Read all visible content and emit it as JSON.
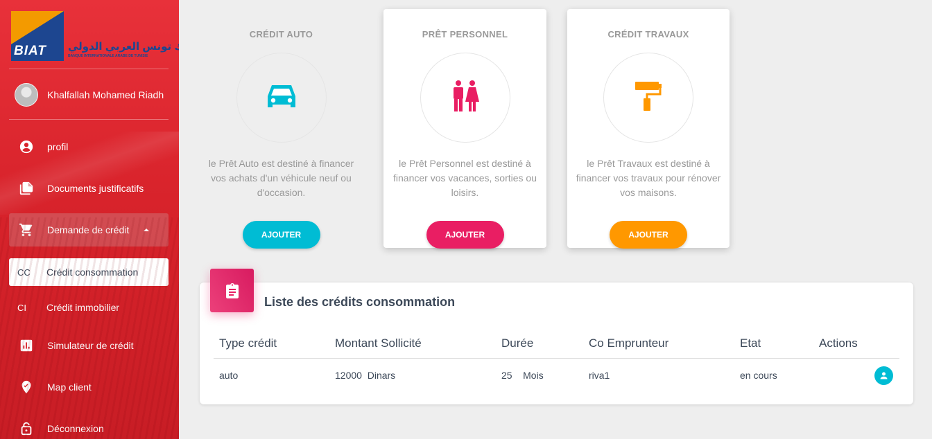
{
  "brand": {
    "logo_text": "BIAT",
    "arabic_name": "بنك تونس العربي الدولي",
    "full_name": "BANQUE INTERNATIONALE ARABE DE TUNISIE",
    "primary_color": "#d8232b",
    "logo_blue": "#1d4690",
    "logo_orange": "#f39a00"
  },
  "user": {
    "name": "Khalfallah Mohamed Riadh",
    "icon": "account-circle-icon"
  },
  "sidebar": {
    "items": [
      {
        "label": "profil",
        "icon": "account-icon"
      },
      {
        "label": "Documents justificatifs",
        "icon": "documents-icon"
      },
      {
        "label": "Demande de crédit",
        "icon": "cart-icon"
      }
    ],
    "submenu": [
      {
        "abbr": "CC",
        "label": "Crédit consommation"
      },
      {
        "abbr": "CI",
        "label": "Crédit immobilier"
      }
    ],
    "bottom_items": [
      {
        "label": "Simulateur de crédit",
        "icon": "chart-icon"
      },
      {
        "label": "Map client",
        "icon": "map-pin-icon"
      },
      {
        "label": "Déconnexion",
        "icon": "lock-icon"
      }
    ]
  },
  "cards": [
    {
      "title": "CRÉDIT AUTO",
      "description": "le Prêt Auto est destiné à financer vos achats d'un véhicule neuf ou d'occasion.",
      "button": "AJOUTER",
      "color": "#00bcd4",
      "icon": "car-icon"
    },
    {
      "title": "PRÊT PERSONNEL",
      "description": "le Prêt Personnel est destiné à financer vos vacances, sorties ou loisirs.",
      "button": "AJOUTER",
      "color": "#e91e63",
      "icon": "people-icon"
    },
    {
      "title": "CRÉDIT TRAVAUX",
      "description": "le Prêt Travaux est destiné à financer vos travaux pour rénover vos maisons.",
      "button": "AJOUTER",
      "color": "#ff9800",
      "icon": "paint-roller-icon"
    }
  ],
  "list": {
    "title": "Liste des crédits consommation",
    "icon": "clipboard-icon",
    "columns": [
      "Type crédit",
      "Montant Sollicité",
      "Durée",
      "Co Emprunteur",
      "Etat",
      "Actions"
    ],
    "rows": [
      {
        "type": "auto",
        "amount": "12000",
        "amount_unit": "Dinars",
        "duration": "25",
        "duration_unit": "Mois",
        "co_borrower": "riva1",
        "status": "en cours"
      }
    ]
  }
}
